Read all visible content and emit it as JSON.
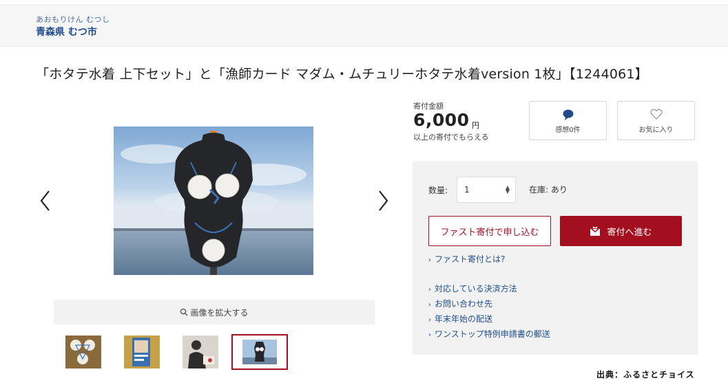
{
  "municipality": {
    "kana": "あおもりけん むつし",
    "name": "青森県 むつ市"
  },
  "product": {
    "title": "「ホタテ水着 上下セット」と「漁師カード マダム・ムチュリーホタテ水着version 1枚」【1244061】"
  },
  "gallery": {
    "zoom_label": "画像を拡大する",
    "thumbnail_count": 4,
    "active_thumbnail": 4
  },
  "donation": {
    "amount_label": "寄付金額",
    "amount": "6,000",
    "unit": "円",
    "note": "以上の寄付でもらえる"
  },
  "impressions": {
    "label": "感想0件"
  },
  "favorite": {
    "label": "お気に入り"
  },
  "order": {
    "quantity_label": "数量:",
    "quantity_value": "1",
    "stock_label": "在庫: あり",
    "fast_button": "ファスト寄付で申し込む",
    "proceed_button": "寄付へ進む"
  },
  "links": [
    "ファスト寄付とは?",
    "対応している決済方法",
    "お問い合わせ先",
    "年末年始の配送",
    "ワンストップ特例申請書の郵送"
  ],
  "credit": "出典：ふるさとチョイス",
  "colors": {
    "accent_red": "#a30f1f",
    "link_blue": "#1f4d8c",
    "panel_gray": "#f2f2f2"
  },
  "icons": {
    "prev": "chevron-left-icon",
    "next": "chevron-right-icon",
    "zoom": "magnifier-icon",
    "impressions": "speech-bubble-icon",
    "favorite": "heart-icon",
    "proceed": "gift-icon",
    "link": "chevron-right-icon"
  }
}
